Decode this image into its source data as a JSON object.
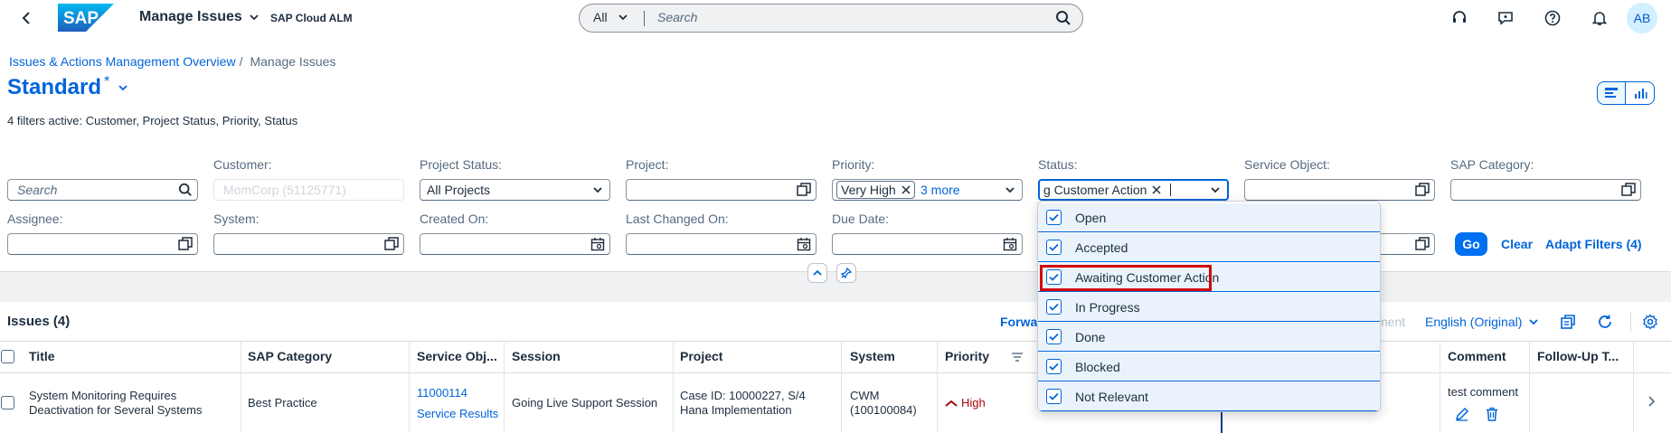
{
  "shell": {
    "title": "Manage Issues",
    "product": "SAP Cloud ALM",
    "scope": "All",
    "search_placeholder": "Search",
    "avatar_initials": "AB",
    "logo_text": "SAP"
  },
  "breadcrumb": {
    "parent": "Issues & Actions Management Overview",
    "separator": "/",
    "current": "Manage Issues"
  },
  "variant": {
    "name": "Standard",
    "modified_marker": "*"
  },
  "filters_summary": "4 filters active: Customer, Project Status, Priority, Status",
  "filters": {
    "search_placeholder": "Search",
    "customer_label": "Customer:",
    "customer_value": "MomCorp (51125771)",
    "project_status_label": "Project Status:",
    "project_status_value": "All Projects",
    "project_label": "Project:",
    "priority_label": "Priority:",
    "priority_token": "Very High",
    "priority_more": "3 more",
    "status_label": "Status:",
    "status_token": "g Customer Action",
    "service_object_label": "Service Object:",
    "sap_category_label": "SAP Category:",
    "assignee_label": "Assignee:",
    "system_label": "System:",
    "created_on_label": "Created On:",
    "last_changed_label": "Last Changed On:",
    "due_date_label": "Due Date:"
  },
  "filter_buttons": {
    "go": "Go",
    "clear": "Clear",
    "adapt": "Adapt Filters (4)"
  },
  "table": {
    "title": "Issues (4)",
    "toolbar_forward": "Forwar",
    "toolbar_hidden": "ment",
    "language": "English (Original)",
    "columns": [
      "Title",
      "SAP Category",
      "Service Obj...",
      "Session",
      "Project",
      "System",
      "Priority",
      "Comment",
      "Follow-Up T..."
    ],
    "rows": [
      {
        "title": "System Monitoring Requires Deactivation for Several Systems",
        "sap_category": "Best Practice",
        "service_obj_id": "11000114",
        "service_obj_link": "Service Results",
        "session": "Going Live Support Session",
        "project": "Case ID: 10000227, S/4 Hana Implementation",
        "system": "CWM (100100084)",
        "priority": "High",
        "comment": "test comment"
      }
    ]
  },
  "status_options": [
    {
      "label": "Open",
      "checked": true
    },
    {
      "label": "Accepted",
      "checked": true
    },
    {
      "label": "Awaiting Customer Action",
      "checked": true
    },
    {
      "label": "In Progress",
      "checked": true
    },
    {
      "label": "Done",
      "checked": true
    },
    {
      "label": "Blocked",
      "checked": true
    },
    {
      "label": "Not Relevant",
      "checked": true
    }
  ],
  "colors": {
    "accent": "#0064d9",
    "brand_blue": "#0070f2",
    "priority_high": "#aa0808",
    "highlight_box": "#d20a0a"
  }
}
